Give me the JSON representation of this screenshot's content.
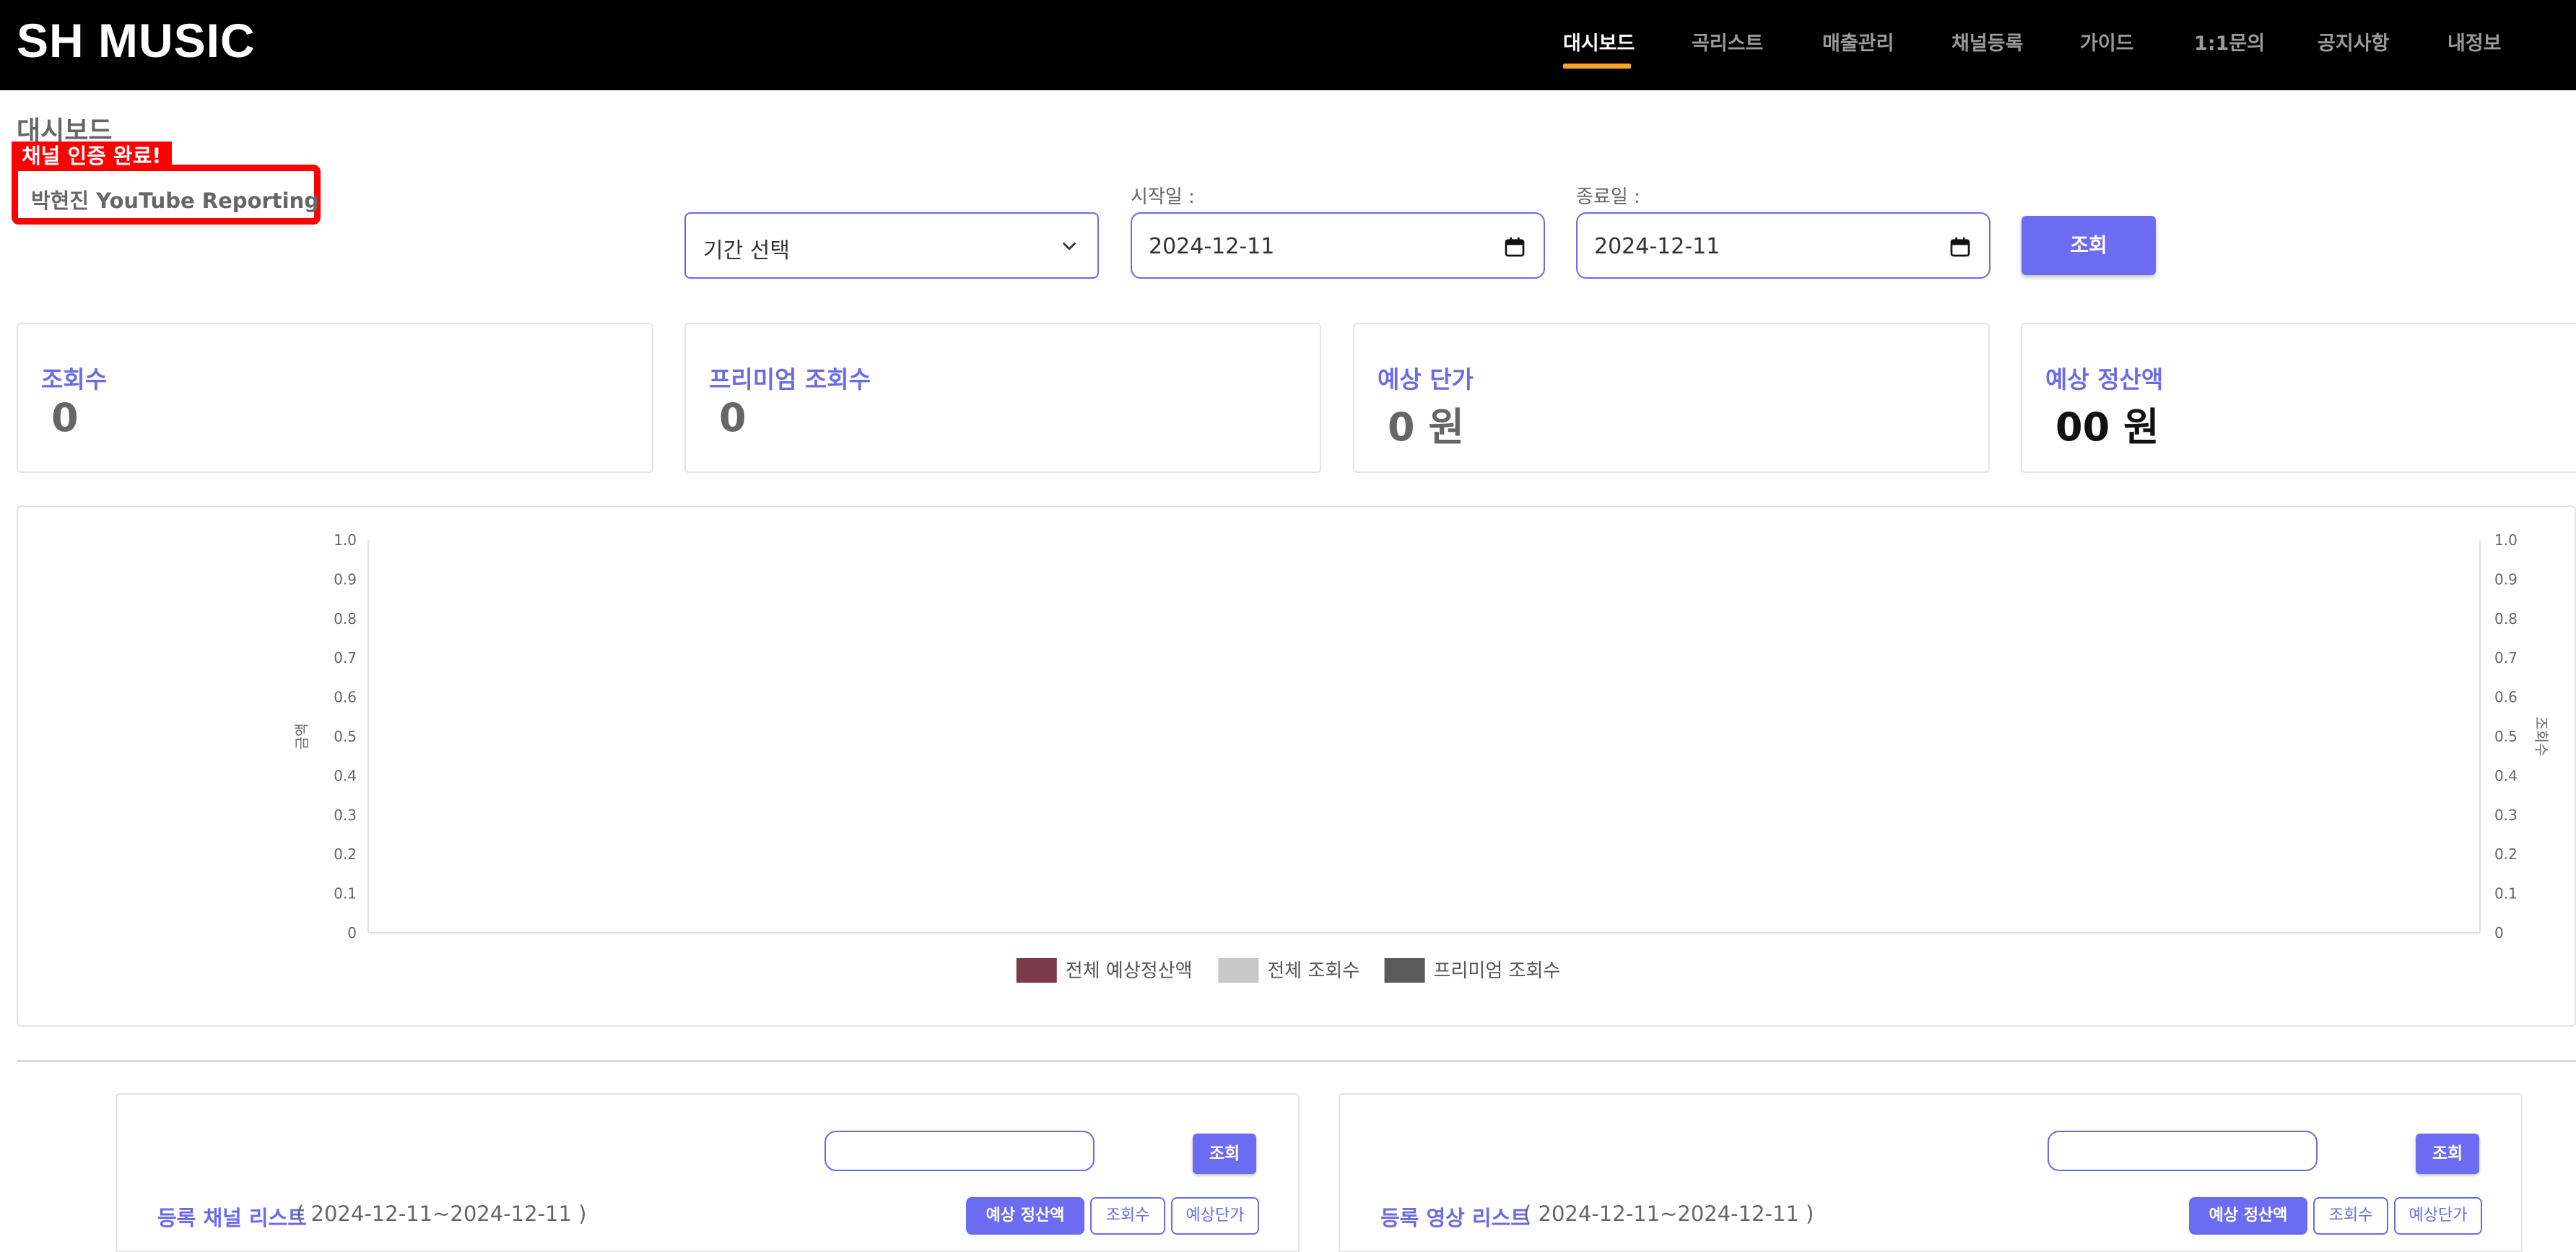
{
  "app": {
    "logo": "SH MUSIC"
  },
  "nav": [
    {
      "label": "대시보드",
      "active": true
    },
    {
      "label": "곡리스트",
      "active": false
    },
    {
      "label": "매출관리",
      "active": false
    },
    {
      "label": "채널등록",
      "active": false
    },
    {
      "label": "가이드",
      "active": false
    },
    {
      "label": "1:1문의",
      "active": false
    },
    {
      "label": "공지사항",
      "active": false
    },
    {
      "label": "내정보",
      "active": false
    }
  ],
  "page": {
    "title": "대시보드"
  },
  "channel": {
    "badge": "채널 인증 완료!",
    "name": "박현진  YouTube Reporting"
  },
  "filters": {
    "period_select": "기간 선택",
    "start_label": "시작일 :",
    "start_date": "2024-12-11",
    "end_label": "종료일 :",
    "end_date": "2024-12-11",
    "query_button": "조회"
  },
  "stats": [
    {
      "label": "조회수",
      "value": "0"
    },
    {
      "label": "프리미엄 조회수",
      "value": "0"
    },
    {
      "label": "예상 단가",
      "value": "0 원"
    },
    {
      "label": "예상 정산액",
      "value": "00 원"
    }
  ],
  "chart_data": {
    "type": "bar",
    "categories": [],
    "series": [
      {
        "name": "전체 예상정산액",
        "color": "#7a3a4b",
        "values": []
      },
      {
        "name": "전체 조회수",
        "color": "#c8c8c8",
        "values": []
      },
      {
        "name": "프리미엄 조회수",
        "color": "#5a5a5a",
        "values": []
      }
    ],
    "ylabel_left": "금액",
    "ylabel_right": "조회수",
    "ylim": [
      0,
      1.0
    ],
    "yticks": [
      "0",
      "0.1",
      "0.2",
      "0.3",
      "0.4",
      "0.5",
      "0.6",
      "0.7",
      "0.8",
      "0.9",
      "1.0"
    ],
    "legend": "bottom-center"
  },
  "lists": [
    {
      "title": "등록 채널 리스트",
      "range": "( 2024-12-11~2024-12-11 )",
      "search_button": "조회",
      "sort_buttons": [
        "예상 정산액",
        "조회수",
        "예상단가"
      ]
    },
    {
      "title": "등록 영상 리스트",
      "range": "( 2024-12-11~2024-12-11 )",
      "search_button": "조회",
      "sort_buttons": [
        "예상 정산액",
        "조회수",
        "예상단가"
      ]
    }
  ]
}
